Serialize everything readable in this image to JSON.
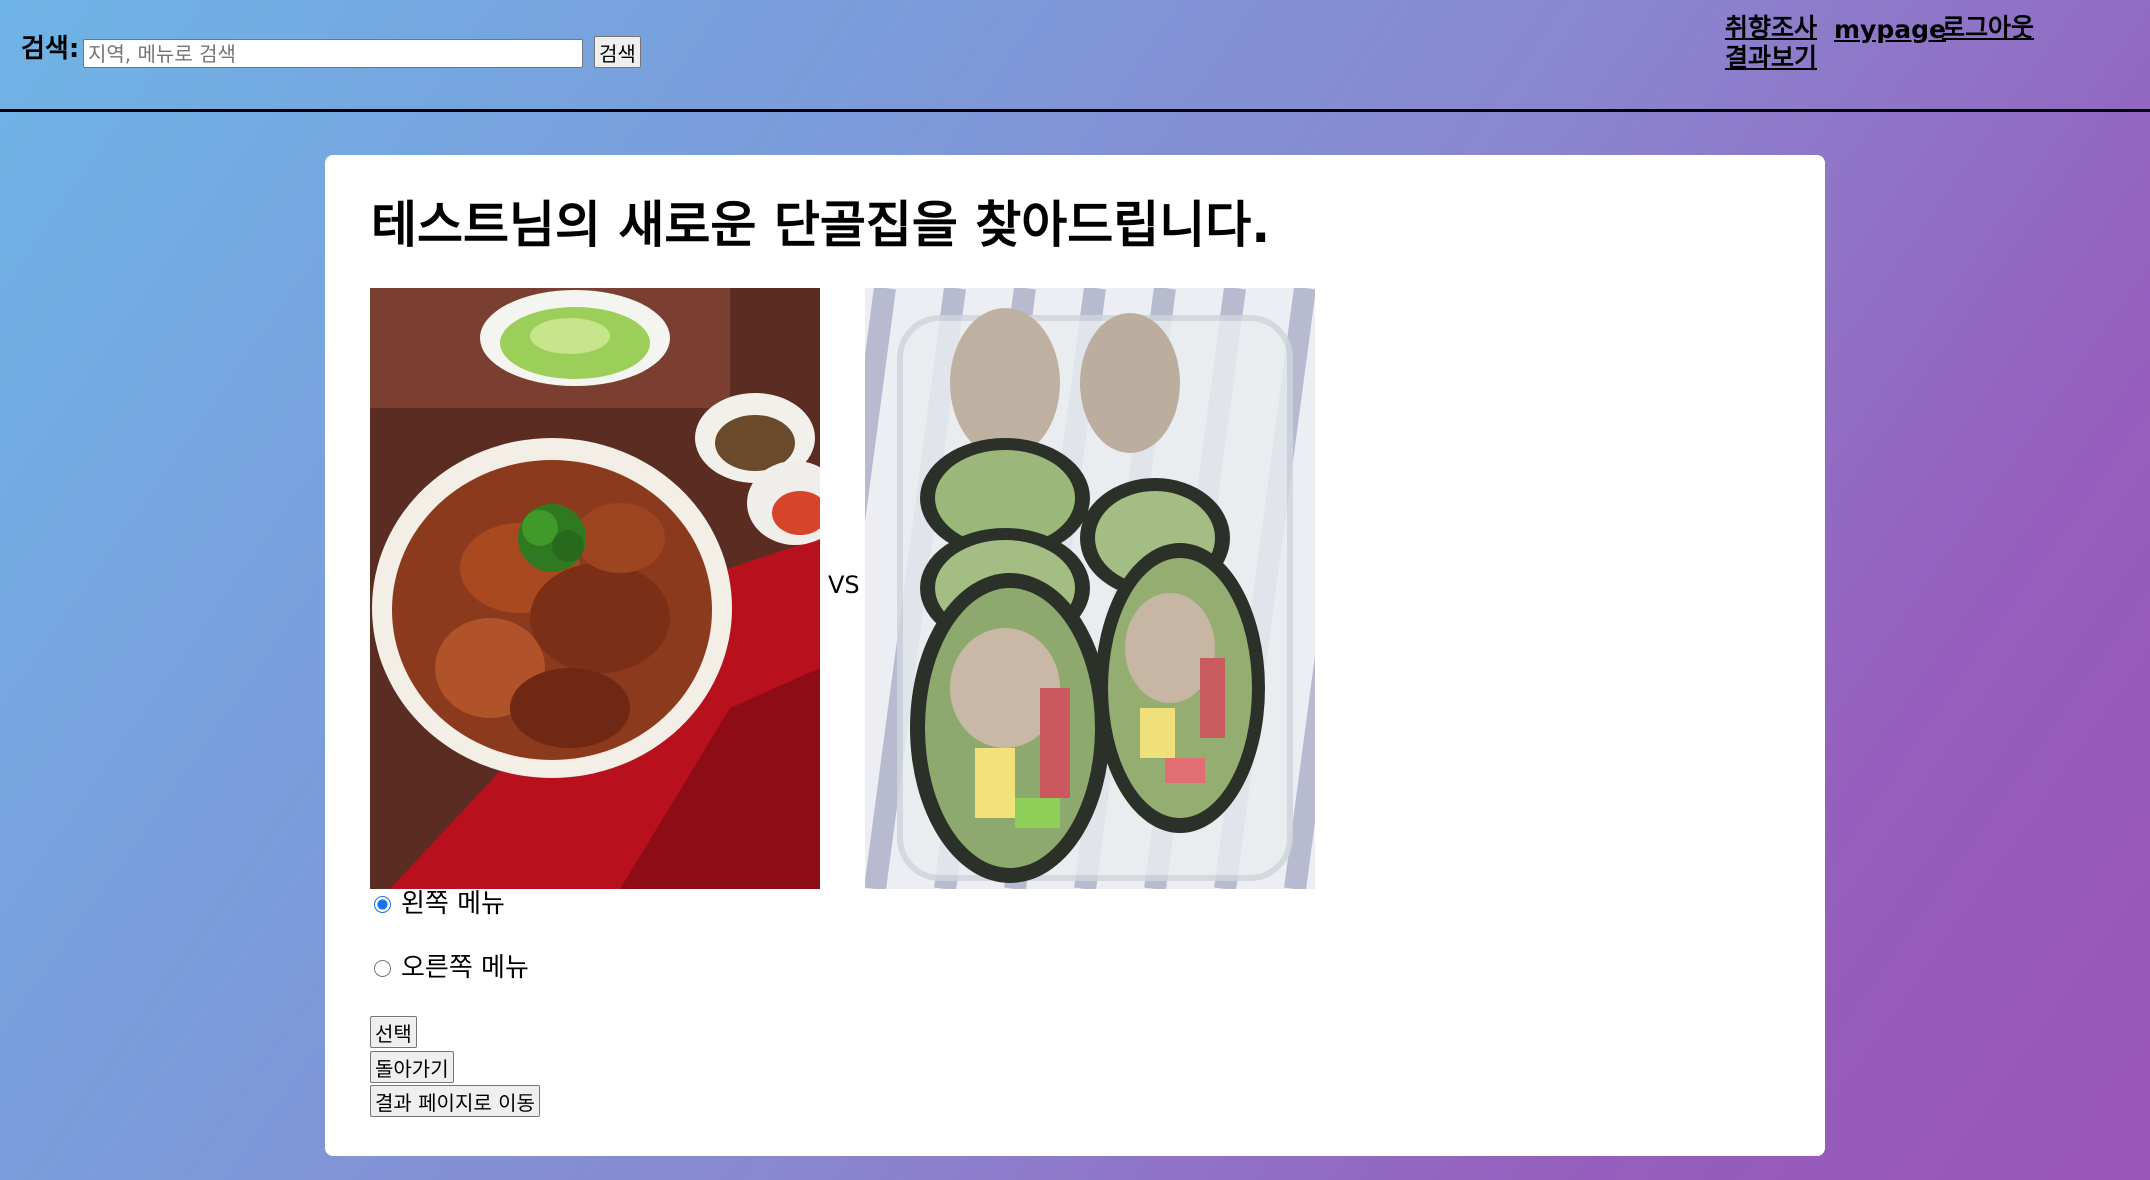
{
  "header": {
    "search_label": "검색:",
    "search_placeholder": "지역, 메뉴로 검색",
    "search_value": "",
    "search_button": "검색",
    "nav": {
      "survey_results": "취향조사 결과보기",
      "mypage": "mypage",
      "logout": "로그아웃"
    }
  },
  "main": {
    "title": "테스트님의 새로운 단골집을 찾아드립니다.",
    "vs_label": "VS",
    "options": {
      "left": {
        "label": "왼쪽 메뉴",
        "selected": true
      },
      "right": {
        "label": "오른쪽 메뉴",
        "selected": false
      }
    },
    "buttons": {
      "select": "선택",
      "back": "돌아가기",
      "go_results": "결과 페이지로 이동"
    }
  },
  "colors": {
    "gradient_start": "#6fb4e6",
    "gradient_end": "#9a55b7",
    "card_background": "#ffffff",
    "radio_accent": "#1a73e8"
  }
}
